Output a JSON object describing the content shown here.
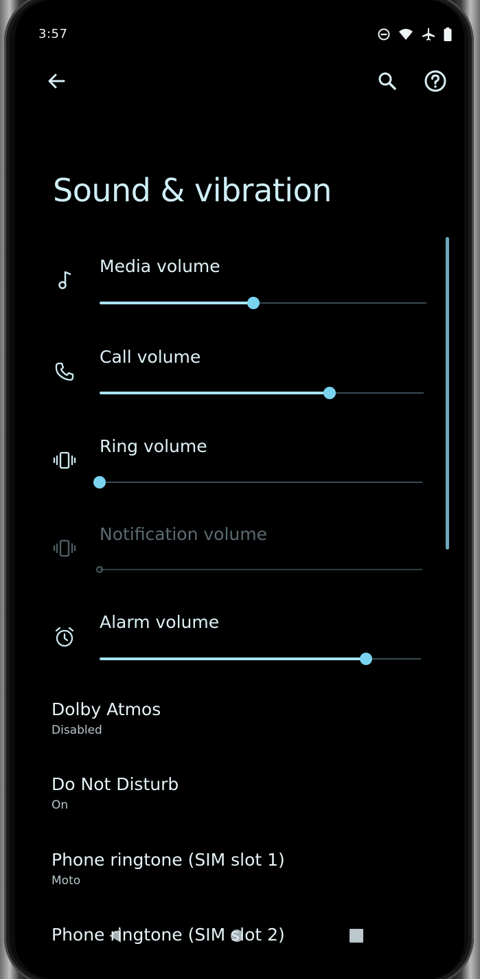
{
  "status_bar": {
    "time": "3:57",
    "icons": [
      "do-not-disturb-icon",
      "wifi-icon",
      "airplane-icon",
      "battery-icon"
    ]
  },
  "toolbar": {
    "back_icon": "arrow-back-icon",
    "search_icon": "search-icon",
    "help_icon": "help-icon"
  },
  "page": {
    "title": "Sound & vibration"
  },
  "volumes": [
    {
      "label": "Media volume",
      "icon": "music-note-icon",
      "level": 0.47,
      "enabled": true
    },
    {
      "label": "Call volume",
      "icon": "phone-icon",
      "level": 0.71,
      "enabled": true
    },
    {
      "label": "Ring volume",
      "icon": "vibrate-icon",
      "level": 0.0,
      "enabled": true
    },
    {
      "label": "Notification volume",
      "icon": "vibrate-icon",
      "level": 0.0,
      "enabled": false
    },
    {
      "label": "Alarm volume",
      "icon": "alarm-icon",
      "level": 0.83,
      "enabled": true
    }
  ],
  "preferences": [
    {
      "title": "Dolby Atmos",
      "summary": "Disabled"
    },
    {
      "title": "Do Not Disturb",
      "summary": "On"
    },
    {
      "title": "Phone ringtone (SIM slot 1)",
      "summary": "Moto"
    },
    {
      "title": "Phone ringtone (SIM slot 2)",
      "summary": ""
    }
  ],
  "nav_bar": {
    "back_icon": "nav-back-icon",
    "home_icon": "nav-home-icon",
    "recents_icon": "nav-recents-icon"
  },
  "colors": {
    "accent": "#7ad4f0",
    "accent_fill": "#a7e4f4",
    "title": "#cfeff7",
    "background": "#000000"
  }
}
